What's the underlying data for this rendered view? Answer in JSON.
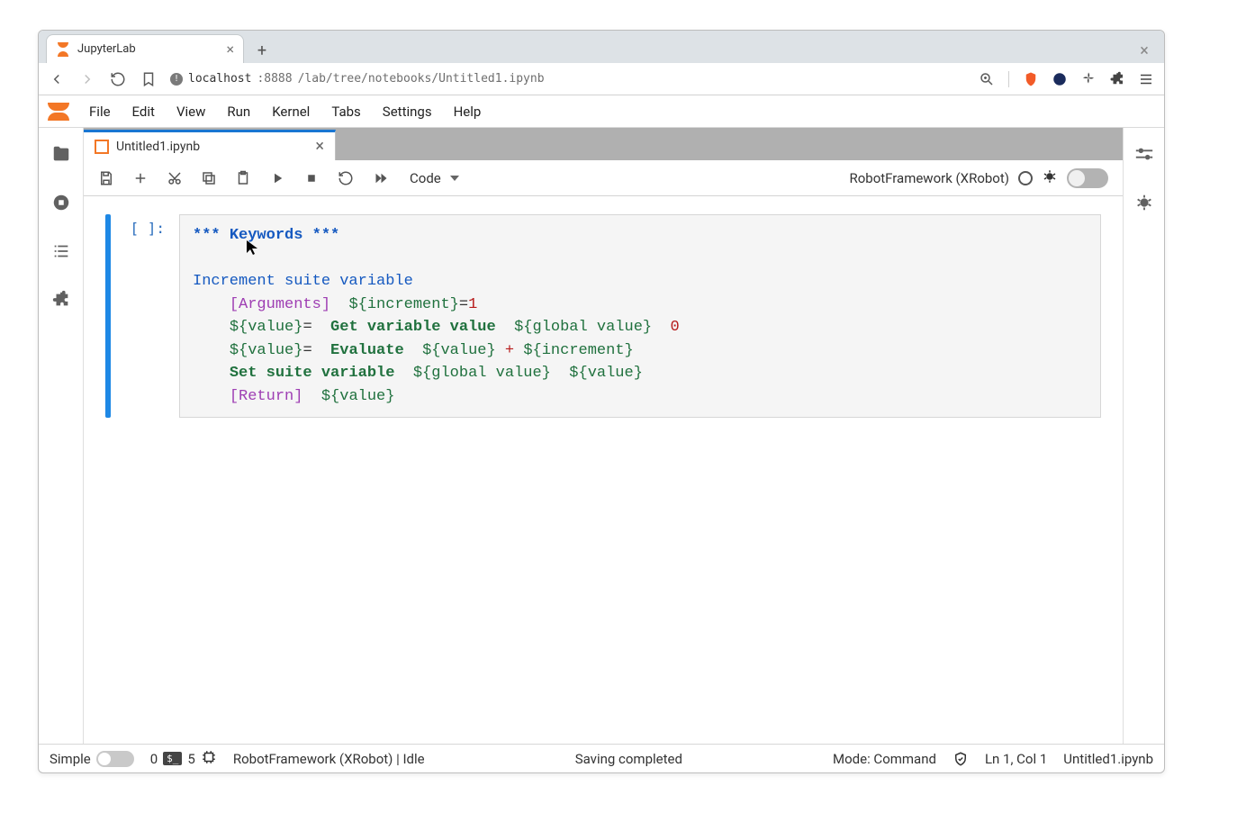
{
  "browser": {
    "tab_title": "JupyterLab",
    "url_host": "localhost",
    "url_port": ":8888",
    "url_path": "/lab/tree/notebooks/Untitled1.ipynb"
  },
  "menubar": {
    "items": [
      "File",
      "Edit",
      "View",
      "Run",
      "Kernel",
      "Tabs",
      "Settings",
      "Help"
    ]
  },
  "doc_tab": {
    "title": "Untitled1.ipynb"
  },
  "toolbar": {
    "cell_type": "Code",
    "kernel_display": "RobotFramework (XRobot)"
  },
  "cell": {
    "prompt": "[ ]:",
    "code": {
      "line1_stars_open": "*** ",
      "line1_kw": "Keywords",
      "line1_stars_close": " ***",
      "blank": "",
      "line3": "Increment suite variable",
      "line4_arguments": "[Arguments]",
      "line4_var": "${increment}",
      "line4_eq": "=",
      "line4_num": "1",
      "line5_lhs": "${value}",
      "line5_eq": "=",
      "line5_kw1": "Get variable value",
      "line5_arg1": "${global value}",
      "line5_num": "0",
      "line6_lhs": "${value}",
      "line6_eq": "=",
      "line6_kw": "Evaluate",
      "line6_a": "${value}",
      "line6_plus": "+",
      "line6_b": "${increment}",
      "line7_kw": "Set suite variable",
      "line7_a": "${global value}",
      "line7_b": "${value}",
      "line8_ret": "[Return]",
      "line8_val": "${value}"
    }
  },
  "statusbar": {
    "simple_label": "Simple",
    "left_count": "0",
    "right_count": "5",
    "kernel": "RobotFramework (XRobot) | Idle",
    "saving": "Saving completed",
    "mode": "Mode: Command",
    "ln_col": "Ln 1, Col 1",
    "filename": "Untitled1.ipynb"
  }
}
